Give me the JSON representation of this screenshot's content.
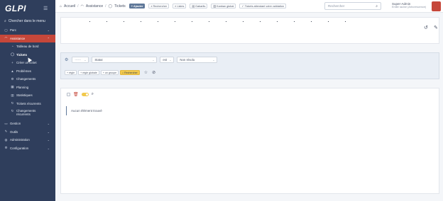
{
  "app": {
    "logo": "GLPI"
  },
  "sidebar": {
    "search_menu_label": "Chercher dans le menu",
    "items": [
      {
        "label": "Parc",
        "icon": "box-icon",
        "type": "section"
      },
      {
        "label": "Assistance",
        "icon": "headset-icon",
        "type": "section-open"
      },
      {
        "label": "Tableau de bord",
        "icon": "dashboard-icon",
        "type": "sub"
      },
      {
        "label": "Tickets",
        "icon": "ticket-icon",
        "type": "sub-active"
      },
      {
        "label": "Créer un ticket",
        "icon": "plus-icon",
        "type": "sub"
      },
      {
        "label": "Problèmes",
        "icon": "alert-icon",
        "type": "sub"
      },
      {
        "label": "Changements",
        "icon": "change-icon",
        "type": "sub"
      },
      {
        "label": "Planning",
        "icon": "calendar-icon",
        "type": "sub"
      },
      {
        "label": "Statistiques",
        "icon": "stats-icon",
        "type": "sub"
      },
      {
        "label": "Tickets récurrents",
        "icon": "recurrent-icon",
        "type": "sub"
      },
      {
        "label": "Changements récurrents",
        "icon": "recurrent-icon",
        "type": "sub-tall"
      },
      {
        "label": "Gestion",
        "icon": "wallet-icon",
        "type": "section"
      },
      {
        "label": "Outils",
        "icon": "tools-icon",
        "type": "section"
      },
      {
        "label": "Administration",
        "icon": "admin-icon",
        "type": "section"
      },
      {
        "label": "Configuration",
        "icon": "gear-icon",
        "type": "section"
      }
    ]
  },
  "topbar": {
    "breadcrumb": [
      "Accueil",
      "Assistance",
      "Tickets"
    ],
    "buttons": [
      "Ajouter",
      "Rechercher",
      "Listes",
      "Gabarits",
      "Kanban global",
      "Tickets attendant votre validation"
    ],
    "search_placeholder": "Rechercher",
    "user_name": "Super-Admin",
    "user_entity": "Entité racine (Arborescence)"
  },
  "criteria": {
    "field_placeholder": "------",
    "field": "Statut",
    "operator": "est",
    "value": "Non résolu",
    "buttons": [
      "règle",
      "règle globale",
      "un groupe",
      "Rechercher"
    ]
  },
  "results": {
    "empty_message": "Aucun élément trouvé"
  },
  "colors": {
    "sidebar_bg": "#2f3e5c",
    "accent": "#c6473a",
    "search_btn": "#f2c94c"
  }
}
